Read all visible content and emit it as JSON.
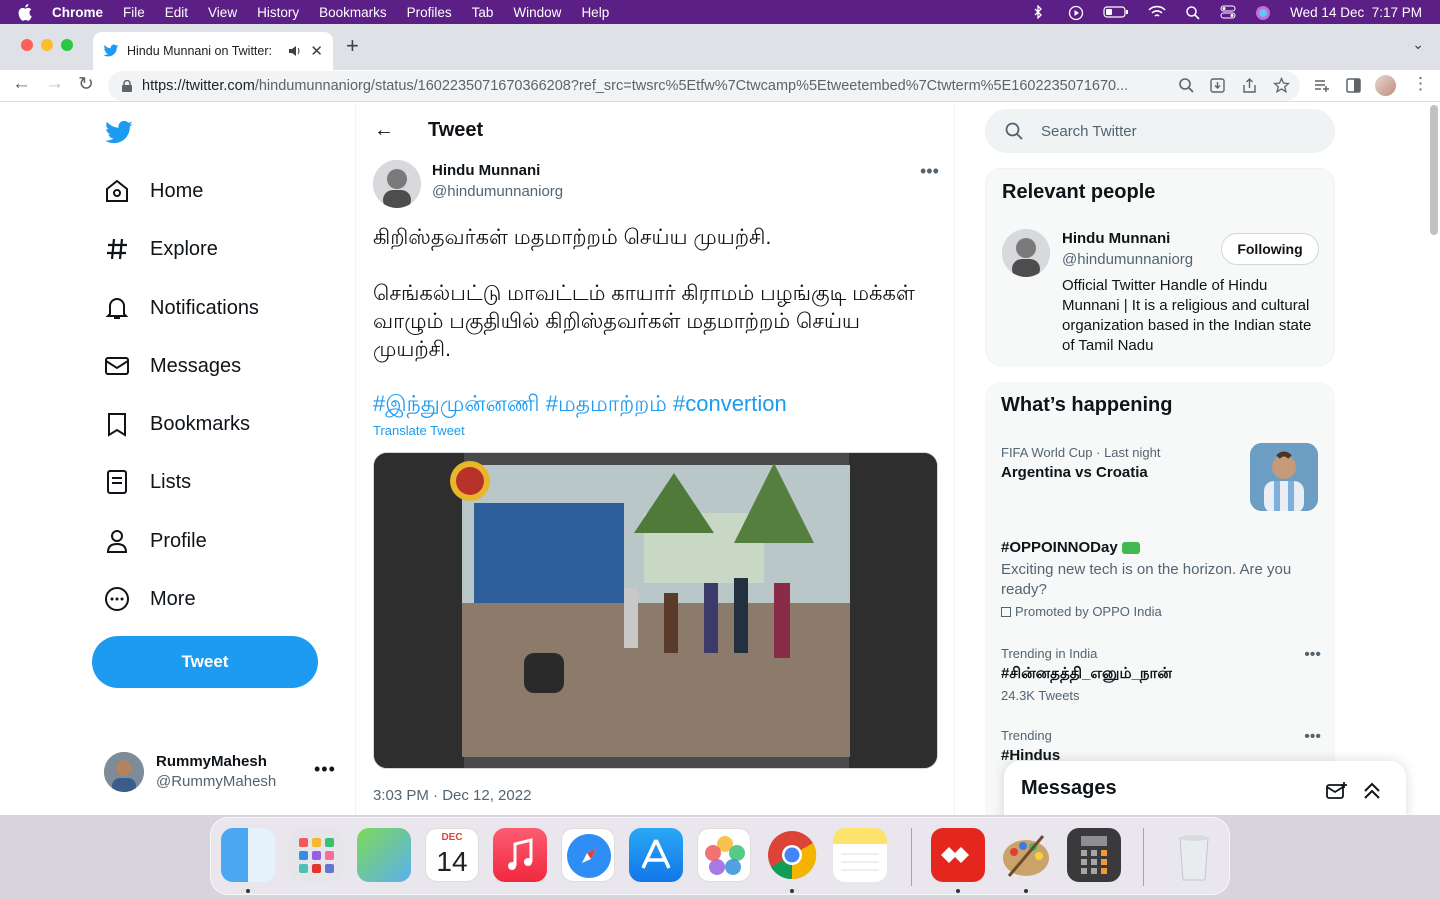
{
  "menubar": {
    "app": "Chrome",
    "items": [
      "File",
      "Edit",
      "View",
      "History",
      "Bookmarks",
      "Profiles",
      "Tab",
      "Window",
      "Help"
    ],
    "datetime": "Wed 14 Dec  7:17 PM"
  },
  "browser": {
    "tab_title": "Hindu Munnani on Twitter:",
    "url_host": "https://twitter.com",
    "url_path": "/hindumunnaniorg/status/1602235071670366208?ref_src=twsrc%5Etfw%7Ctwcamp%5Etweetembed%7Ctwterm%5E1602235071670..."
  },
  "nav": {
    "items": [
      {
        "label": "Home",
        "icon": "home-icon"
      },
      {
        "label": "Explore",
        "icon": "hashtag-icon"
      },
      {
        "label": "Notifications",
        "icon": "bell-icon"
      },
      {
        "label": "Messages",
        "icon": "envelope-icon"
      },
      {
        "label": "Bookmarks",
        "icon": "bookmark-icon"
      },
      {
        "label": "Lists",
        "icon": "list-icon"
      },
      {
        "label": "Profile",
        "icon": "person-icon"
      },
      {
        "label": "More",
        "icon": "more-circle-icon"
      }
    ],
    "tweet_button": "Tweet",
    "account": {
      "name": "RummyMahesh",
      "handle": "@RummyMahesh"
    }
  },
  "tweet": {
    "header": "Tweet",
    "author_name": "Hindu Munnani",
    "author_handle": "@hindumunnaniorg",
    "line1": "கிறிஸ்தவர்கள் மதமாற்றம் செய்ய முயற்சி.",
    "line2": "செங்கல்பட்டு மாவட்டம் காயார் கிராமம் பழங்குடி மக்கள் வாழும் பகுதியில் கிறிஸ்தவர்கள் மதமாற்றம் செய்ய முயற்சி.",
    "hashtags": "#இந்துமுன்னணி #மதமாற்றம் #convertion",
    "translate": "Translate Tweet",
    "timestamp": "3:03 PM · Dec 12, 2022"
  },
  "sidebar": {
    "search_placeholder": "Search Twitter",
    "relevant": {
      "heading": "Relevant people",
      "name": "Hindu Munnani",
      "handle": "@hindumunnaniorg",
      "follow": "Following",
      "bio": "Official Twitter Handle of Hindu Munnani | It is a religious and cultural organization based in the Indian state of Tamil Nadu"
    },
    "happening": {
      "heading": "What’s happening",
      "t1_meta": "FIFA World Cup · Last night",
      "t1_title": "Argentina vs Croatia",
      "t2_title": "#OPPOINNODay",
      "t2_desc": "Exciting new tech is on the horizon. Are you ready?",
      "t2_promo": "Promoted by OPPO India",
      "t3_meta": "Trending in India",
      "t3_title": "#சின்னதத்தி_எனும்_நான்",
      "t3_count": "24.3K Tweets",
      "t4_meta": "Trending",
      "t4_title": "#Hindus"
    },
    "messages_drawer": "Messages"
  },
  "dock": {
    "calendar_month": "DEC",
    "calendar_day": "14"
  },
  "colors": {
    "twitter_blue": "#1d9bf0",
    "menubar": "#5b1f86"
  }
}
